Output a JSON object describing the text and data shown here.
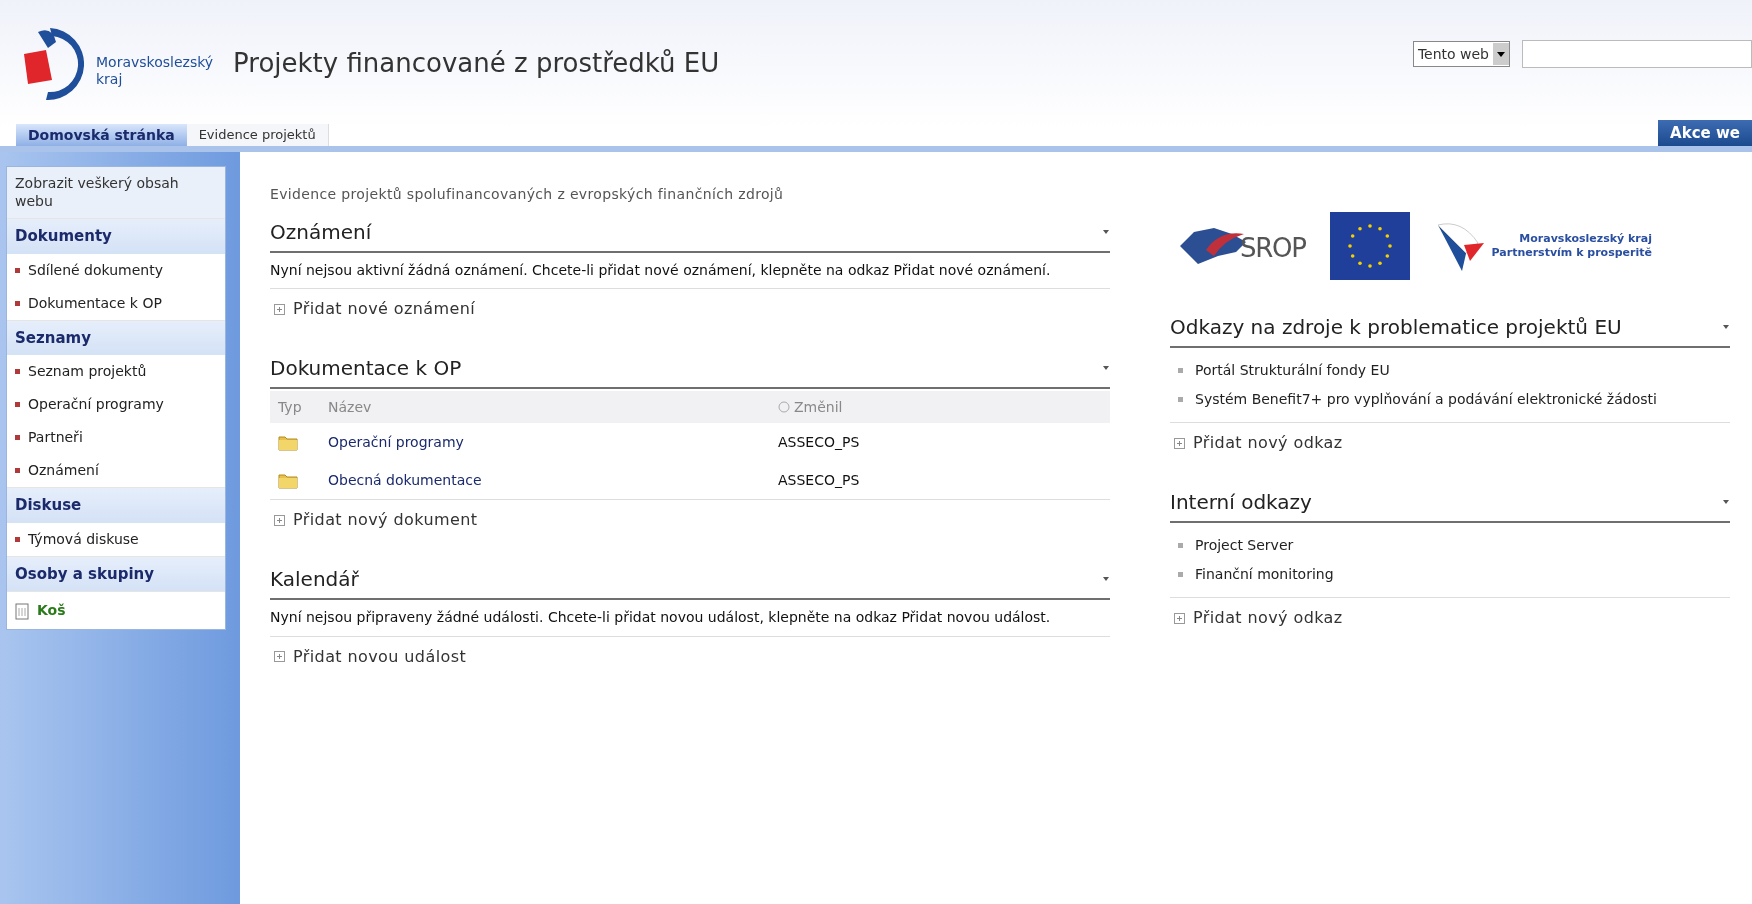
{
  "header": {
    "logo_text": "Moravskoslezský",
    "logo_subtext": "kraj",
    "site_title": "Projekty financované z prostředků EU",
    "search_scope": "Tento web"
  },
  "tabs": [
    {
      "label": "Domovská stránka",
      "selected": true
    },
    {
      "label": "Evidence projektů",
      "selected": false
    }
  ],
  "site_actions": "Akce we",
  "sidebar": {
    "items": [
      {
        "kind": "link",
        "label": "Zobrazit veškerý obsah webu"
      },
      {
        "kind": "heading",
        "label": "Dokumenty"
      },
      {
        "kind": "bullet",
        "label": "Sdílené dokumenty"
      },
      {
        "kind": "bullet",
        "label": "Dokumentace k OP"
      },
      {
        "kind": "heading",
        "label": "Seznamy"
      },
      {
        "kind": "bullet",
        "label": "Seznam projektů"
      },
      {
        "kind": "bullet",
        "label": "Operační programy"
      },
      {
        "kind": "bullet",
        "label": "Partneři"
      },
      {
        "kind": "bullet",
        "label": "Oznámení"
      },
      {
        "kind": "heading",
        "label": "Diskuse"
      },
      {
        "kind": "bullet",
        "label": "Týmová diskuse"
      },
      {
        "kind": "heading",
        "label": "Osoby a skupiny"
      },
      {
        "kind": "recycle",
        "label": "Koš"
      }
    ]
  },
  "page_description": "Evidence projektů spolufinancovaných z evropských finančních zdrojů",
  "left_webparts": [
    {
      "kind": "message",
      "title": "Oznámení",
      "text": "Nyní nejsou aktivní žádná oznámení. Chcete-li přidat nové oznámení, klepněte na odkaz Přidat nové oznámení.",
      "add_link": "Přidat nové oznámení"
    },
    {
      "kind": "table",
      "title": "Dokumentace k OP",
      "columns": [
        "Typ",
        "Název",
        "Změnil"
      ],
      "rows": [
        {
          "name": "Operační programy",
          "modified_by": "ASSECO_PS"
        },
        {
          "name": "Obecná dokumentace",
          "modified_by": "ASSECO_PS"
        }
      ],
      "add_link": "Přidat nový dokument"
    },
    {
      "kind": "message",
      "title": "Kalendář",
      "text": "Nyní nejsou připraveny žádné události. Chcete-li přidat novou událost, klepněte na odkaz Přidat novou událost.",
      "add_link": "Přidat novou událost"
    }
  ],
  "logos": {
    "srop": "SROP",
    "region_line_1": "Moravskoslezský kraj",
    "region_line_2": "Partnerstvím k prosperitě"
  },
  "right_webparts": [
    {
      "title": "Odkazy na zdroje k problematice projektů EU",
      "links": [
        "Portál Strukturální fondy EU",
        "Systém Benefit7+ pro vyplňování a podávání elektronické žádosti"
      ],
      "add_link": "Přidat nový odkaz"
    },
    {
      "title": "Interní odkazy",
      "links": [
        "Project Server",
        "Finanční monitoring"
      ],
      "add_link": "Přidat nový odkaz"
    }
  ]
}
